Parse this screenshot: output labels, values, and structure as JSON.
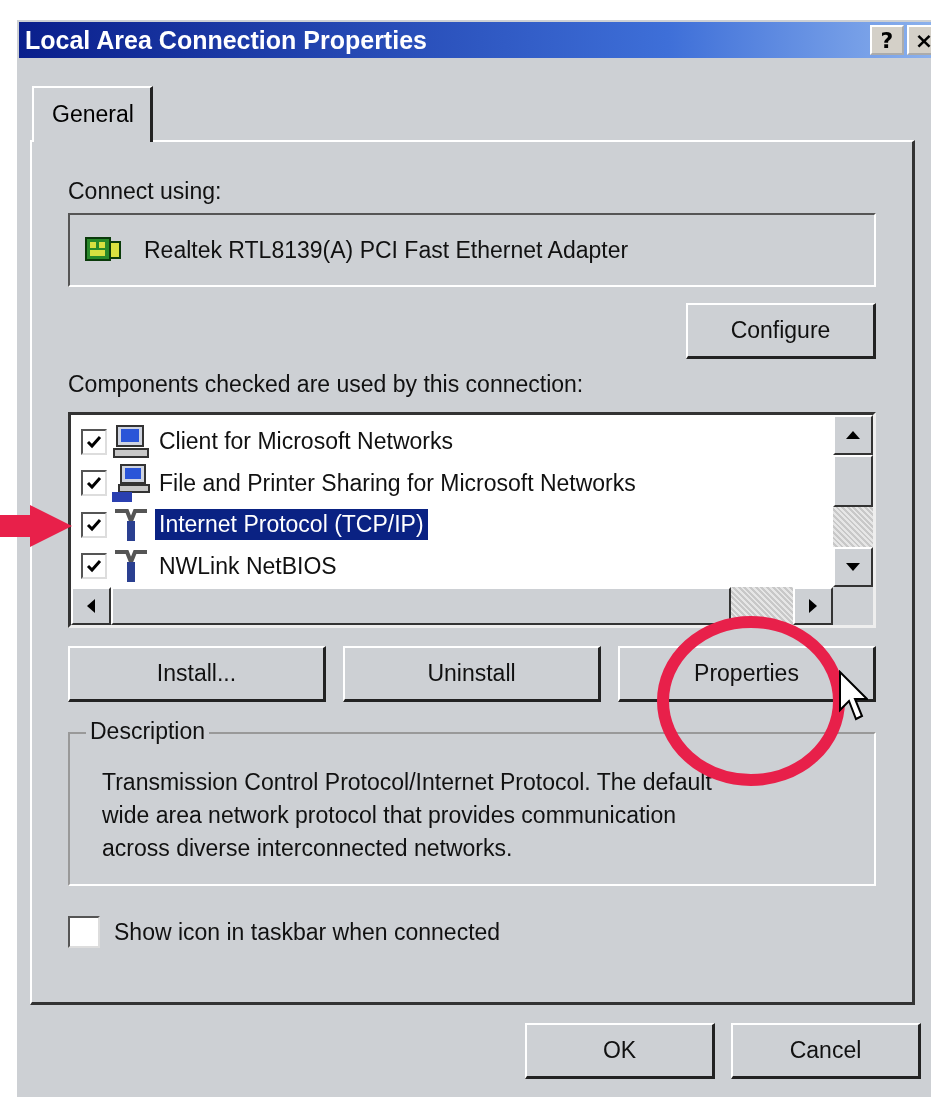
{
  "window": {
    "title": "Local Area Connection Properties",
    "title_buttons": [
      "?",
      "×"
    ]
  },
  "tabs": [
    {
      "label": "General",
      "selected": true
    }
  ],
  "connect_using": {
    "label": "Connect using:",
    "adapter": "Realtek RTL8139(A) PCI Fast Ethernet Adapter",
    "button": "Configure"
  },
  "components": {
    "label": "Components checked are used by this connection:",
    "items": [
      {
        "label": "Client for Microsoft Networks",
        "checked": true,
        "selected": false,
        "kind": "client"
      },
      {
        "label": "File and Printer Sharing for Microsoft Networks",
        "checked": true,
        "selected": false,
        "kind": "service"
      },
      {
        "label": "Internet Protocol (TCP/IP)",
        "checked": true,
        "selected": true,
        "kind": "protocol"
      },
      {
        "label": "NWLink NetBIOS",
        "checked": true,
        "selected": false,
        "kind": "protocol"
      }
    ]
  },
  "buttons": [
    "Install...",
    "Uninstall",
    "Properties"
  ],
  "description": {
    "title": "Description",
    "text": "Transmission Control Protocol/Internet Protocol. The default\nwide area network protocol that provides communication\nacross diverse interconnected networks."
  },
  "show_icon": {
    "label": "Show icon in taskbar when connected",
    "checked": false
  },
  "footer_buttons": [
    "OK",
    "Cancel"
  ]
}
